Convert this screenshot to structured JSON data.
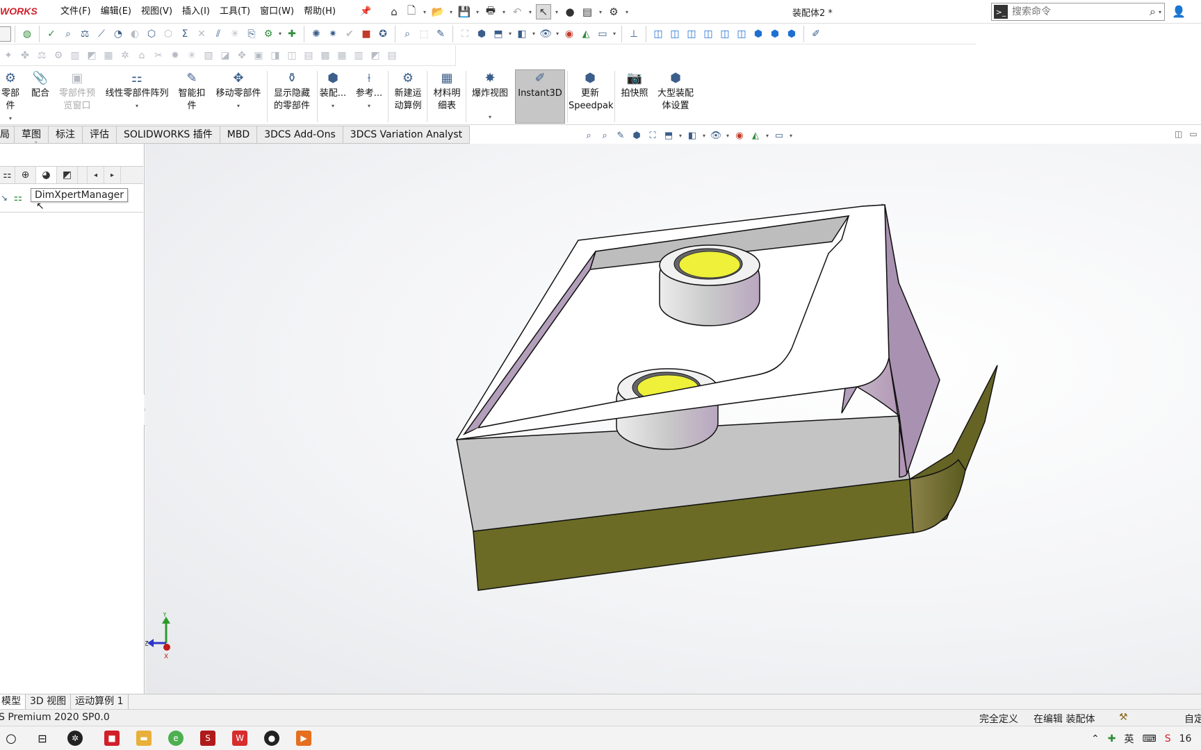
{
  "app": {
    "logo_text": "WORKS",
    "document_title": "装配体2 *"
  },
  "menu": [
    "文件(F)",
    "编辑(E)",
    "视图(V)",
    "插入(I)",
    "工具(T)",
    "窗口(W)",
    "帮助(H)"
  ],
  "search": {
    "placeholder": "搜索命令"
  },
  "command_manager": {
    "insert_part": "零部件",
    "mate": "配合",
    "preview_line1": "零部件预",
    "preview_line2": "览窗口",
    "linear_pattern": "线性零部件阵列",
    "smart_fastener_line1": "智能扣",
    "smart_fastener_line2": "件",
    "move_component": "移动零部件",
    "show_hidden_line1": "显示隐藏",
    "show_hidden_line2": "的零部件",
    "assembly_features": "装配...",
    "reference_geometry": "参考...",
    "new_motion_line1": "新建运",
    "new_motion_line2": "动算例",
    "bom_line1": "材料明",
    "bom_line2": "细表",
    "exploded_view": "爆炸视图",
    "instant3d": "Instant3D",
    "speedpak_line1": "更新",
    "speedpak_line2": "Speedpak",
    "snapshot": "拍快照",
    "large_assembly_line1": "大型装配",
    "large_assembly_line2": "体设置"
  },
  "tabs": [
    "局",
    "草图",
    "标注",
    "评估",
    "SOLIDWORKS 插件",
    "MBD",
    "3DCS Add-Ons",
    "3DCS Variation Analyst"
  ],
  "left_panel": {
    "tooltip": "DimXpertManager"
  },
  "bottom_tabs": [
    "模型",
    "3D 视图",
    "运动算例 1"
  ],
  "status": {
    "version": "S Premium 2020 SP0.0",
    "defined": "完全定义",
    "editing": "在编辑 装配体",
    "custom": "自定"
  },
  "triad": {
    "y": "Y",
    "z": "Z",
    "x": "X"
  },
  "taskbar": {
    "ime": "英",
    "clock": "16"
  },
  "colors": {
    "lid_green": "#6b6b26",
    "wall_purple": "#b6a3bd",
    "wall_gray": "#c4c4c4",
    "boss_yellow": "#eef03a",
    "instant3d_active": "#c6c6c6"
  }
}
